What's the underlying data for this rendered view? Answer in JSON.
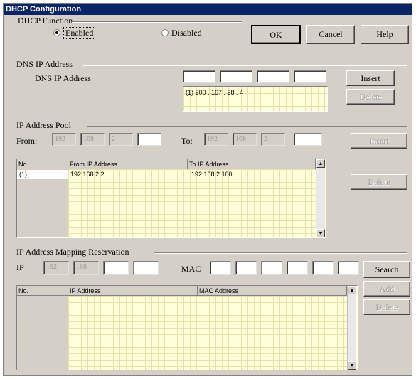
{
  "window": {
    "title": "DHCP Configuration"
  },
  "dhcp": {
    "group_label": "DHCP Function",
    "enabled_label": "Enabled",
    "disabled_label": "Disabled",
    "selected": "enabled"
  },
  "buttons": {
    "ok": "OK",
    "cancel": "Cancel",
    "help": "Help"
  },
  "dns": {
    "group_label": "DNS IP Address",
    "field_label": "DNS IP Address",
    "octets": [
      "",
      "",
      "",
      ""
    ],
    "list_entry": "(1) 200 . 167 . 28 . 4",
    "insert_label": "Insert",
    "delete_label": "Delete"
  },
  "pool": {
    "group_label": "IP Address Pool",
    "from_label": "From:",
    "to_label": "To:",
    "from_octets": [
      "192",
      "168",
      "2",
      ""
    ],
    "to_octets": [
      "192",
      "168",
      "2",
      ""
    ],
    "insert_label": "Insert",
    "delete_label": "Delete",
    "columns": [
      "No.",
      "From IP Address",
      "To IP Address"
    ],
    "rows": [
      {
        "no": "(1)",
        "from": "192.168.2.2",
        "to": "192.168.2.100"
      }
    ]
  },
  "mapping": {
    "group_label": "IP Address Mapping Reservation",
    "ip_label": "IP",
    "mac_label": "MAC",
    "ip_octets": [
      "192",
      "168",
      "",
      ""
    ],
    "mac_octets": [
      "",
      "",
      "",
      "",
      "",
      ""
    ],
    "search_label": "Search",
    "add_label": "Add",
    "delete_label": "Delete",
    "columns": [
      "No.",
      "IP Address",
      "MAC Address"
    ],
    "rows": []
  }
}
